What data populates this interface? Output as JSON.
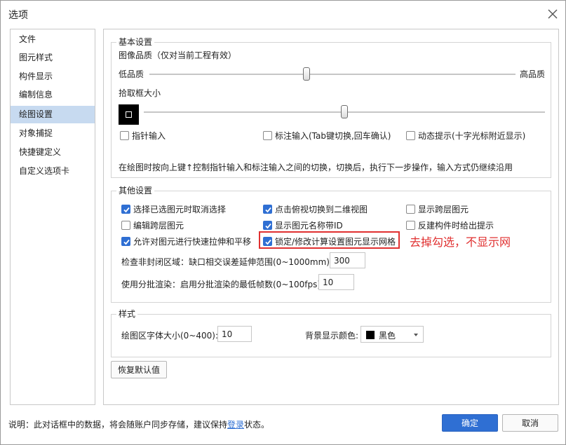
{
  "window": {
    "title": "选项"
  },
  "nav": {
    "items": [
      {
        "label": "文件",
        "active": false
      },
      {
        "label": "图元样式",
        "active": false
      },
      {
        "label": "构件显示",
        "active": false
      },
      {
        "label": "编制信息",
        "active": false
      },
      {
        "label": "绘图设置",
        "active": true
      },
      {
        "label": "对象捕捉",
        "active": false
      },
      {
        "label": "快捷键定义",
        "active": false
      },
      {
        "label": "自定义选项卡",
        "active": false
      }
    ]
  },
  "basic": {
    "title": "基本设置",
    "image_quality_label": "图像品质（仅对当前工程有效）",
    "low_label": "低品质",
    "high_label": "高品质",
    "quality_level": 0.43,
    "pick_box_label": "拾取框大小",
    "pick_box_level": 0.5,
    "pointer_input": {
      "label": "指针输入",
      "checked": false
    },
    "dim_input": {
      "label": "标注输入(Tab键切换,回车确认)",
      "checked": false
    },
    "dynamic_hint": {
      "label": "动态提示(十字光标附近显示)",
      "checked": false
    },
    "description": "在绘图时按向上键↑控制指针输入和标注输入之间的切换，切换后，执行下一步操作，输入方式仍继续沿用"
  },
  "other": {
    "title": "其他设置",
    "checkboxes": [
      {
        "label": "选择已选图元时取消选择",
        "checked": true
      },
      {
        "label": "点击俯视切换到二维视图",
        "checked": true
      },
      {
        "label": "显示跨层图元",
        "checked": false
      },
      {
        "label": "编辑跨层图元",
        "checked": false
      },
      {
        "label": "显示图元名称带ID",
        "checked": true
      },
      {
        "label": "反建构件时给出提示",
        "checked": false
      },
      {
        "label": "允许对图元进行快速拉伸和平移",
        "checked": true
      },
      {
        "label": "锁定/修改计算设置图元显示网格",
        "checked": true
      }
    ],
    "gap_label": "检查非封闭区域：缺口相交误差延伸范围(0~1000mm):",
    "gap_value": "300",
    "batch_label": "使用分批渲染：启用分批渲染的最低帧数(0~100fps):",
    "batch_value": "10"
  },
  "annotation": {
    "text": "去掉勾选，不显示网",
    "color": "#e03030"
  },
  "style": {
    "title": "样式",
    "font_size_label": "绘图区字体大小(0~400):",
    "font_size_value": "10",
    "bg_color_label": "背景显示颜色:",
    "bg_color_value": "黑色",
    "bg_color_hex": "#000000"
  },
  "buttons": {
    "restore": "恢复默认值",
    "ok": "确定",
    "cancel": "取消"
  },
  "footer": {
    "note_prefix": "说明：此对话框中的数据，将会随账户同步存储，建议保持",
    "note_link": "登录",
    "note_suffix": "状态。"
  },
  "colors": {
    "accent": "#2f6fd3",
    "nav_active": "#c7daf0"
  }
}
